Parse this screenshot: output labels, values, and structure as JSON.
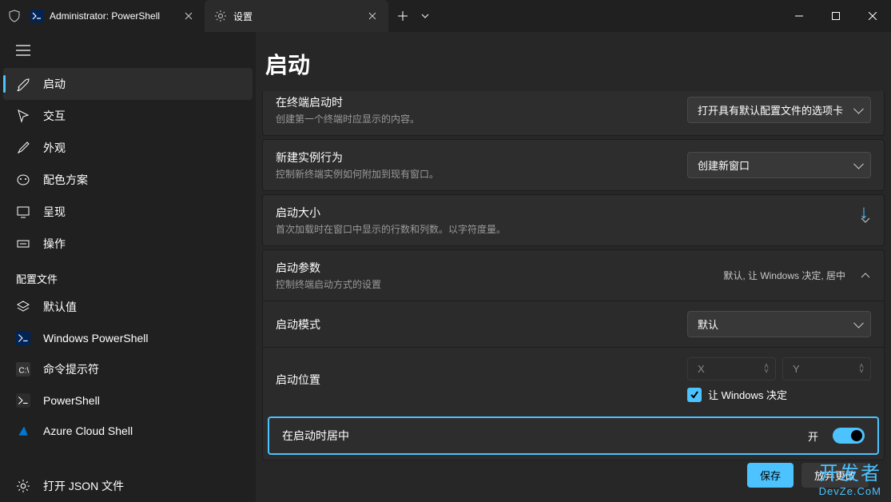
{
  "titlebar": {
    "tabs": [
      {
        "label": "Administrator: PowerShell",
        "active": false
      },
      {
        "label": "设置",
        "active": true
      }
    ]
  },
  "sidebar": {
    "items": [
      {
        "label": "启动",
        "selected": true
      },
      {
        "label": "交互"
      },
      {
        "label": "外观"
      },
      {
        "label": "配色方案"
      },
      {
        "label": "呈现"
      },
      {
        "label": "操作"
      }
    ],
    "profiles_header": "配置文件",
    "profiles": [
      {
        "label": "默认值"
      },
      {
        "label": "Windows PowerShell"
      },
      {
        "label": "命令提示符"
      },
      {
        "label": "PowerShell"
      },
      {
        "label": "Azure Cloud Shell"
      }
    ],
    "bottom": {
      "label": "打开 JSON 文件"
    }
  },
  "page": {
    "title": "启动",
    "cards": {
      "startup_content": {
        "title": "在终端启动时",
        "sub": "创建第一个终端时应显示的内容。",
        "value": "打开具有默认配置文件的选项卡"
      },
      "new_instance": {
        "title": "新建实例行为",
        "sub": "控制新终端实例如何附加到现有窗口。",
        "value": "创建新窗口"
      },
      "launch_size": {
        "title": "启动大小",
        "sub": "首次加载时在窗口中显示的行数和列数。以字符度量。"
      },
      "launch_params": {
        "title": "启动参数",
        "sub": "控制终端启动方式的设置",
        "summary": "默认, 让 Windows 决定, 居中"
      },
      "launch_mode": {
        "label": "启动模式",
        "value": "默认"
      },
      "launch_pos": {
        "label": "启动位置",
        "x_placeholder": "X",
        "y_placeholder": "Y",
        "checkbox_label": "让 Windows 决定"
      },
      "center": {
        "label": "在启动时居中",
        "state": "开"
      }
    },
    "buttons": {
      "save": "保存",
      "discard": "放弃更改"
    }
  },
  "watermark": {
    "cn": "开发者",
    "en": "DevZe.CoM"
  }
}
